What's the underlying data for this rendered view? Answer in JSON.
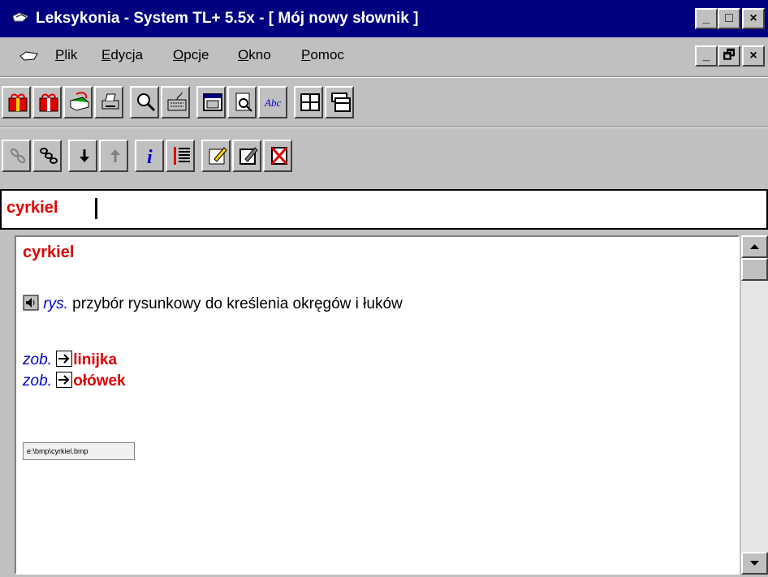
{
  "window": {
    "title": "Leksykonia - System TL+ 5.5x - [ Mój nowy słownik ]",
    "title_buttons": [
      "_",
      "□",
      "×"
    ],
    "doc_buttons": [
      "_",
      "🗗",
      "×"
    ]
  },
  "menu": {
    "items": [
      "Plik",
      "Edycja",
      "Opcje",
      "Okno",
      "Pomoc"
    ]
  },
  "search": {
    "value": "cyrkiel"
  },
  "entry": {
    "headword": "cyrkiel",
    "abbr": "rys.",
    "definition": " przybór rysunkowy do kreślenia okręgów i łuków",
    "xrefs": [
      {
        "prefix": "zob.",
        "target": "linijka"
      },
      {
        "prefix": "zob.",
        "target": "ołówek"
      }
    ],
    "image_caption": "e:\\bmp\\cyrkiel.bmp"
  },
  "colors": {
    "titlebar": "#000080",
    "headword": "#e00000",
    "abbr": "#0000d0"
  }
}
